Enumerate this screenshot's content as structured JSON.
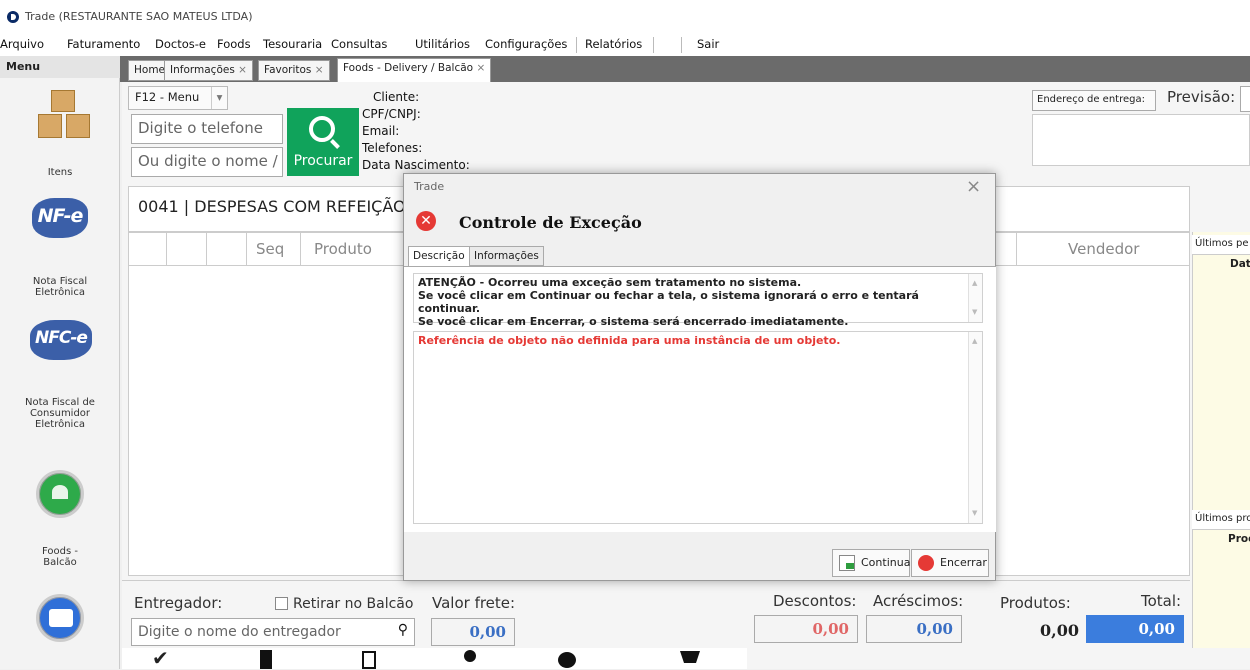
{
  "window": {
    "title": "Trade (RESTAURANTE SAO MATEUS LTDA)"
  },
  "menubar": [
    "Arquivo",
    "Faturamento",
    "Doctos-e",
    "Foods",
    "Tesouraria",
    "Consultas",
    "Utilitários",
    "Configurações",
    "Relatórios",
    "Sair"
  ],
  "leftmenu": {
    "header": "Menu",
    "items": [
      {
        "label": "Itens",
        "icon": "boxes-icon"
      },
      {
        "label": "Nota Fiscal Eletrônica",
        "icon": "nfe-map-icon",
        "badge": "NF-e"
      },
      {
        "label": "Nota Fiscal de Consumidor Eletrônica",
        "icon": "nfce-map-icon",
        "badge": "NFC-e"
      },
      {
        "label": "Foods - Balcão",
        "icon": "foods-icon"
      }
    ]
  },
  "tabs": [
    {
      "label": "Home",
      "closable": false
    },
    {
      "label": "Informações",
      "closable": true
    },
    {
      "label": "Favoritos",
      "closable": true
    },
    {
      "label": "Foods - Delivery / Balcão",
      "closable": true,
      "active": true
    }
  ],
  "form": {
    "menu_button": "F12 - Menu",
    "phone_placeholder": "Digite o telefone",
    "name_placeholder": "Ou digite o nome /",
    "search_button": "Procurar",
    "client_fields": [
      "Cliente:",
      "CPF/CNPJ:",
      "Email:",
      "Telefones:",
      "Data Nascimento:"
    ],
    "address_button": "Endereço de entrega:",
    "forecast_label": "Previsão:"
  },
  "customer_bar": "0041 | DESPESAS COM REFEIÇÃO |",
  "grid": {
    "columns": [
      "Seq",
      "Produto",
      "Vendedor"
    ]
  },
  "right_panel": {
    "section1_title": "Últimos pe",
    "section1_col": "Dat",
    "section2_title": "Últimos pro",
    "section2_col": "Proc"
  },
  "bottom": {
    "deliverer_label": "Entregador:",
    "pickup_label": "Retirar no Balcão",
    "deliverer_placeholder": "Digite o nome do entregador",
    "freight_label": "Valor frete:",
    "freight_value": "0,00",
    "discounts_label": "Descontos:",
    "discounts_value": "0,00",
    "additions_label": "Acréscimos:",
    "additions_value": "0,00",
    "products_label": "Produtos:",
    "products_value": "0,00",
    "total_label": "Total:",
    "total_value": "0,00"
  },
  "dialog": {
    "title": "Trade",
    "heading": "Controle de Exceção",
    "tabs": [
      "Descrição",
      "Informações"
    ],
    "message_lines": [
      "ATENÇÃO - Ocorreu uma exceção sem tratamento no sistema.",
      "Se você clicar em Continuar ou fechar a tela, o sistema ignorará o erro e tentará continuar.",
      "Se você clicar em Encerrar, o sistema será encerrado imediatamente."
    ],
    "error_text": "Referência de objeto não definida para uma instância de um objeto.",
    "continue_button": "Continuar",
    "close_button": "Encerrar"
  },
  "colors": {
    "search_green": "#10a35b",
    "total_blue": "#3b7ddd",
    "error_red": "#e53935",
    "discount_red": "#e06666"
  }
}
